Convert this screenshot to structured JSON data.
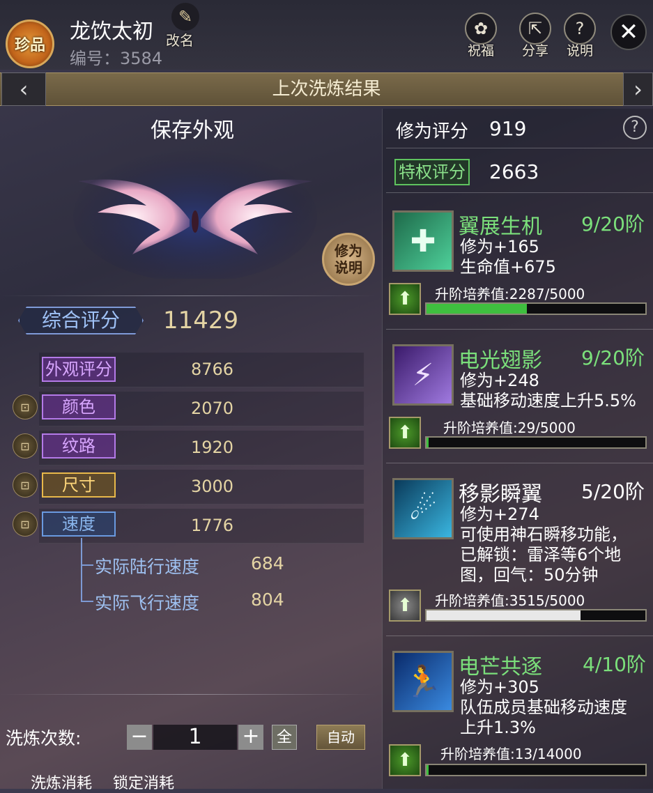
{
  "header": {
    "badge": "珍品",
    "name": "龙饮太初",
    "id_label": "编号：3584",
    "rename_label": "改名",
    "buttons": [
      {
        "label": "祝福",
        "icon": "blessing-icon"
      },
      {
        "label": "分享",
        "icon": "share-icon"
      },
      {
        "label": "说明",
        "icon": "help-icon"
      }
    ]
  },
  "banner": {
    "title": "上次洗炼结果"
  },
  "left": {
    "save_title": "保存外观",
    "xiuwei_btn": "修为说明",
    "overall": {
      "label": "综合评分",
      "value": "11429"
    },
    "attrs": [
      {
        "label": "外观评分",
        "value": "8766",
        "locked": false,
        "color": "#c08af0"
      },
      {
        "label": "颜色",
        "value": "2070",
        "locked": true,
        "color": "#c08af0"
      },
      {
        "label": "纹路",
        "value": "1920",
        "locked": true,
        "color": "#c08af0"
      },
      {
        "label": "尺寸",
        "value": "3000",
        "locked": true,
        "color": "#f0c060"
      },
      {
        "label": "速度",
        "value": "1776",
        "locked": true,
        "color": "#8ab6ee"
      }
    ],
    "sub_attrs": [
      {
        "label": "实际陆行速度",
        "value": "684"
      },
      {
        "label": "实际飞行速度",
        "value": "804"
      }
    ],
    "count": {
      "label": "洗炼次数:",
      "value": "1",
      "minus": "−",
      "plus": "+",
      "all": "全",
      "auto": "自动"
    },
    "footer": {
      "cost1": "洗炼消耗",
      "cost2": "锁定消耗"
    }
  },
  "right": {
    "xiuwei": {
      "label": "修为评分",
      "value": "919",
      "help": "?"
    },
    "tequan": {
      "label": "特权评分",
      "value": "2663"
    },
    "skills": [
      {
        "name": "翼展生机",
        "tier": "9/20阶",
        "name_color": "#7be07b",
        "desc": [
          "修为+165",
          "生命值+675"
        ],
        "up_label": "升阶培养值:2287/5000",
        "progress": 0.4574,
        "bar_color": "#3fbf3f",
        "icon": "heal-icon",
        "up_active": true
      },
      {
        "name": "电光翅影",
        "tier": "9/20阶",
        "name_color": "#7be07b",
        "desc": [
          "修为+248",
          "基础移动速度上升5.5%"
        ],
        "up_label": "升阶培养值:29/5000",
        "progress": 0.0058,
        "bar_color": "#3fbf3f",
        "icon": "lightning-wing-icon",
        "up_active": true
      },
      {
        "name": "移影瞬翼",
        "tier": "5/20阶",
        "name_color": "#ffffff",
        "desc": [
          "修为+274",
          "可使用神石瞬移功能，",
          "已解锁：雷泽等6个地",
          "图，回气：50分钟"
        ],
        "up_label": "升阶培养值:3515/5000",
        "progress": 0.703,
        "bar_color": "#e8e8e8",
        "icon": "teleport-icon",
        "up_active": false
      },
      {
        "name": "电芒共逐",
        "tier": "4/10阶",
        "name_color": "#7be07b",
        "desc": [
          "修为+305",
          "队伍成员基础移动速度",
          "上升1.3%"
        ],
        "up_label": "升阶培养值:13/14000",
        "progress": 0.0009,
        "bar_color": "#3fbf3f",
        "icon": "team-run-icon",
        "up_active": true
      }
    ]
  }
}
